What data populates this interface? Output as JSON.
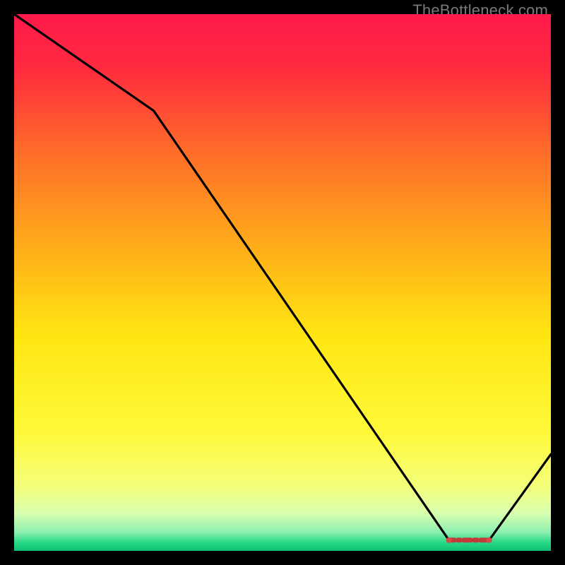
{
  "watermark": "TheBottleneck.com",
  "chart_data": {
    "type": "line",
    "x": [
      0,
      2.6,
      8.1,
      8.85,
      10
    ],
    "values": [
      10,
      8.2,
      0.2,
      0.2,
      1.8
    ],
    "xlim": [
      0,
      10
    ],
    "ylim": [
      0,
      10
    ],
    "xlabel": "",
    "ylabel": "",
    "title": "",
    "background_gradient": {
      "stops": [
        {
          "offset": 0.0,
          "color": "#ff1a4b"
        },
        {
          "offset": 0.1,
          "color": "#ff2a3f"
        },
        {
          "offset": 0.25,
          "color": "#ff6a2a"
        },
        {
          "offset": 0.45,
          "color": "#ffb318"
        },
        {
          "offset": 0.6,
          "color": "#ffe612"
        },
        {
          "offset": 0.78,
          "color": "#fff93a"
        },
        {
          "offset": 0.88,
          "color": "#f4ff7a"
        },
        {
          "offset": 0.93,
          "color": "#d9ffb0"
        },
        {
          "offset": 0.965,
          "color": "#8cf0b0"
        },
        {
          "offset": 0.985,
          "color": "#25d886"
        },
        {
          "offset": 1.0,
          "color": "#0fbf74"
        }
      ]
    },
    "flat_segment": {
      "x_start": 8.1,
      "x_end": 8.85,
      "y": 0.2,
      "marker_color": "#d64a4a",
      "marker_radius": 4,
      "dash_fill": "#c23b3b"
    }
  }
}
